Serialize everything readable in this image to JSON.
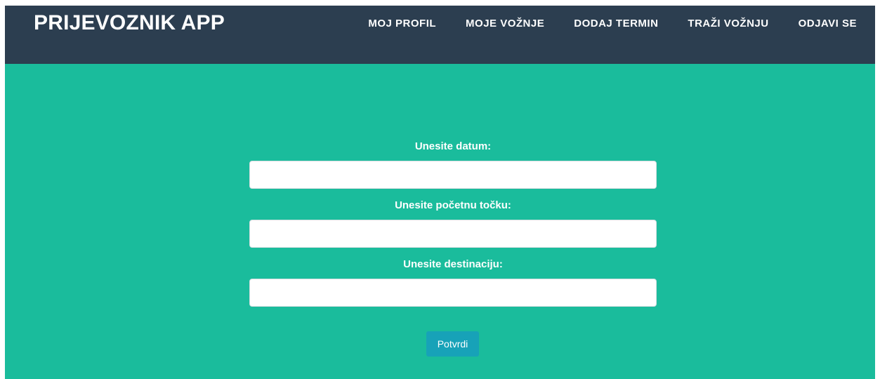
{
  "header": {
    "brand": "PRIJEVOZNIK APP",
    "nav": [
      {
        "label": "MOJ PROFIL"
      },
      {
        "label": "MOJE VOŽNJE"
      },
      {
        "label": "DODAJ TERMIN"
      },
      {
        "label": "TRAŽI VOŽNJU"
      },
      {
        "label": "ODJAVI SE"
      }
    ]
  },
  "form": {
    "date_label": "Unesite datum:",
    "date_value": "",
    "start_label": "Unesite početnu točku:",
    "start_value": "",
    "destination_label": "Unesite destinaciju:",
    "destination_value": "",
    "submit_label": "Potvrdi"
  },
  "colors": {
    "navbar": "#2c3e50",
    "main_background": "#1abc9c",
    "button": "#17a2b8"
  }
}
